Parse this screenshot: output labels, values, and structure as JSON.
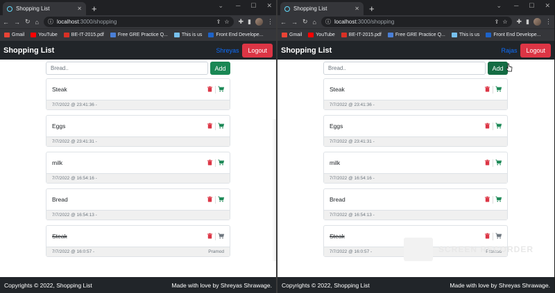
{
  "browser": {
    "tab_title": "Shopping List",
    "url_host": "localhost",
    "url_path": ":3000/shopping",
    "bookmarks": [
      {
        "label": "Gmail",
        "color": "#ea4335"
      },
      {
        "label": "YouTube",
        "color": "#ff0000"
      },
      {
        "label": "BE-IT-2015.pdf",
        "color": "#d93025"
      },
      {
        "label": "Free GRE Practice Q...",
        "color": "#4a7fd6"
      },
      {
        "label": "This is us",
        "color": "#77c0ee"
      },
      {
        "label": "Front End Develope...",
        "color": "#1e63c8"
      }
    ]
  },
  "app": {
    "brand": "Shopping List",
    "logout_label": "Logout",
    "input_placeholder": "Bread..",
    "add_label": "Add",
    "footer_left": "Copyrights © 2022, Shopping List",
    "footer_right": "Made with love by Shreyas Shrawage.",
    "colors": {
      "danger": "#dc3545",
      "success": "#198754",
      "navbar": "#212529",
      "link": "#0d6efd"
    }
  },
  "windows": [
    {
      "user": "Shreyas",
      "items": [
        {
          "name": "Steak",
          "date": "7/7/2022 @ 23:41:36 -",
          "by": "",
          "done": false
        },
        {
          "name": "Eggs",
          "date": "7/7/2022 @ 23:41:31 -",
          "by": "",
          "done": false
        },
        {
          "name": "milk",
          "date": "7/7/2022 @ 16:54:16 -",
          "by": "",
          "done": false
        },
        {
          "name": "Bread",
          "date": "7/7/2022 @ 16:54:13 -",
          "by": "",
          "done": false
        },
        {
          "name": "Steak",
          "date": "7/7/2022 @ 16:0:57 -",
          "by": "Pramod",
          "done": true
        }
      ]
    },
    {
      "user": "Rajas",
      "items": [
        {
          "name": "Steak",
          "date": "7/7/2022 @ 23:41:36 -",
          "by": "",
          "done": false
        },
        {
          "name": "Eggs",
          "date": "7/7/2022 @ 23:41:31 -",
          "by": "",
          "done": false
        },
        {
          "name": "milk",
          "date": "7/7/2022 @ 16:54:16 -",
          "by": "",
          "done": false
        },
        {
          "name": "Bread",
          "date": "7/7/2022 @ 16:54:13 -",
          "by": "",
          "done": false
        },
        {
          "name": "Steak",
          "date": "7/7/2022 @ 16:0:57 -",
          "by": "Pramod",
          "done": true
        }
      ]
    }
  ],
  "watermark": "SCREEN RECORDER"
}
